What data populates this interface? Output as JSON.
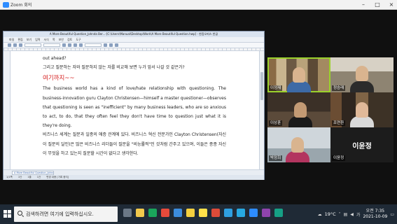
{
  "zoom": {
    "title": "Zoom 회의"
  },
  "document": {
    "title_bar": "A More Beautiful Question_Johnda Ber...-[C:\\Users\\Manual\\Desktop\\Work\\A More Beautiful Question.hwp] - 한컴오피스 한글",
    "menu": [
      "파일",
      "편집",
      "보기",
      "입력",
      "서식",
      "쪽",
      "보안",
      "검토",
      "도구"
    ],
    "paragraphs": [
      "out ahead?",
      "그리고 질문하는 자와 질문하지 않는 자를 비교해 보면 누가 앞서 나갈 것 같은가?",
      "The business world has a kind of love/hate relationship with questioning. The business-innovation guru Clayton Christensen—himself a master questioner—observes that questioning is seen as \"inefficient\" by many business leaders, who are so anxious to act, to do, that they often feel they don't have time to question just what it is they're doing.",
      "비즈니스 세계는 질문과 일종의 애증 관계에 있다. 비즈니스 혁신 전문가인 Clayton Christensen(자신이 질문의 달인)은 많은 비즈니스 리더들이 질문을 \"비능률적\"인 것처럼 간주고 있으며, 이들은 종종 자신이 무엇을 하고 있는지 질문할 시간이 없다고 생각한다."
    ],
    "red_note": "여기까지~~",
    "tab_label": "A More Beautiful Question_Johnda",
    "status": [
      "1/1쪽",
      "1단",
      "1줄",
      "1칸",
      "변경 내용 [기록 중지]"
    ]
  },
  "participants": [
    {
      "name": "이정재",
      "active": true
    },
    {
      "name": "정승래",
      "active": false
    },
    {
      "name": "이상훈",
      "active": false
    },
    {
      "name": "조연환",
      "active": false
    },
    {
      "name": "박정희",
      "active": false
    },
    {
      "name": "이윤정",
      "active": false
    }
  ],
  "taskbar": {
    "search_placeholder": "검색하려면 여기에 입력하십시오.",
    "temperature": "19°C",
    "ime": "가",
    "time": "오전 7:35",
    "date": "2021-10-09"
  }
}
